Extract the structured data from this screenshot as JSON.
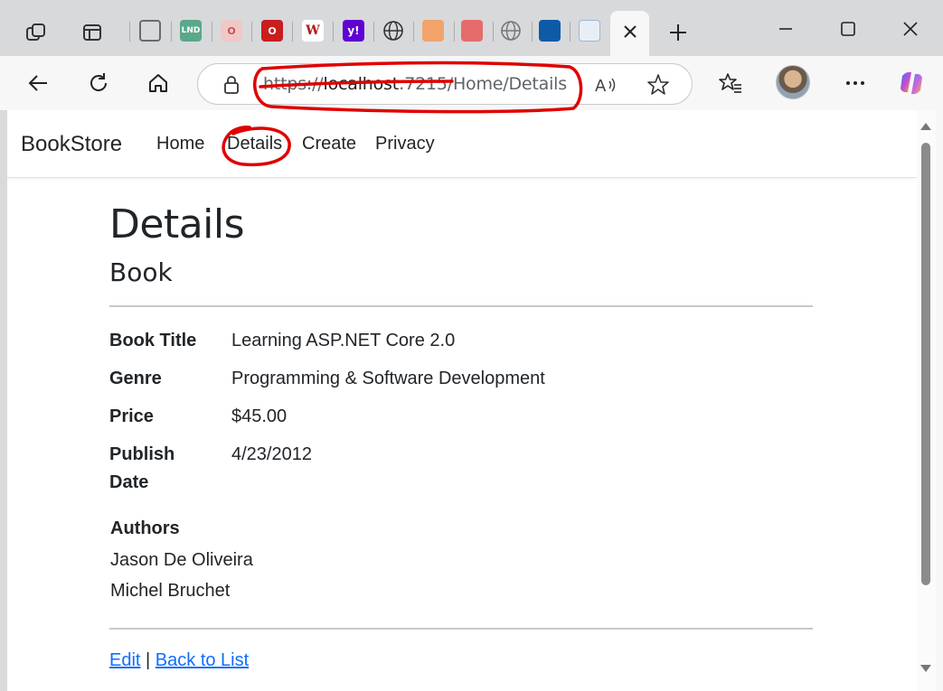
{
  "browser": {
    "url_scheme": "https://",
    "url_host": "localhost",
    "url_rest": ":7215/Home/Details",
    "tab_favicons": [
      {
        "name": "tab-favicon-workspace",
        "text": "",
        "color": "#6b6b6b"
      },
      {
        "name": "tab-favicon-lnd",
        "text": "LND",
        "color": "#5aa88a"
      },
      {
        "name": "tab-favicon-opera-1",
        "text": "O",
        "color": "#e8a0a0"
      },
      {
        "name": "tab-favicon-opera-2",
        "text": "O",
        "color": "#c81e1e"
      },
      {
        "name": "tab-favicon-w",
        "text": "W",
        "color": "#ffffff"
      },
      {
        "name": "tab-favicon-yahoo",
        "text": "y!",
        "color": "#6001d2"
      },
      {
        "name": "tab-favicon-globe-1",
        "text": "",
        "color": "#444444"
      },
      {
        "name": "tab-favicon-orange",
        "text": "",
        "color": "#f2a36b"
      },
      {
        "name": "tab-favicon-red",
        "text": "",
        "color": "#e66c6c"
      },
      {
        "name": "tab-favicon-globe-2",
        "text": "",
        "color": "#777777"
      },
      {
        "name": "tab-favicon-blue",
        "text": "",
        "color": "#0d5aa7"
      },
      {
        "name": "tab-favicon-doc",
        "text": "",
        "color": "#9bb7d4"
      }
    ]
  },
  "navbar": {
    "brand": "BookStore",
    "links": [
      "Home",
      "Details",
      "Create",
      "Privacy"
    ]
  },
  "page": {
    "title": "Details",
    "subtitle": "Book",
    "fields": [
      {
        "label": "Book Title",
        "value": "Learning ASP.NET Core 2.0"
      },
      {
        "label": "Genre",
        "value": "Programming & Software Development"
      },
      {
        "label": "Price",
        "value": "$45.00"
      },
      {
        "label": "Publish Date",
        "value": "4/23/2012"
      }
    ],
    "authors_heading": "Authors",
    "authors": [
      "Jason De Oliveira",
      "Michel Bruchet"
    ],
    "edit_link": "Edit",
    "separator": "|",
    "back_link": "Back to List"
  },
  "colors": {
    "link": "#0d6efd",
    "annotation": "#e00000",
    "text": "#212529"
  },
  "icons": [
    "workspaces-icon",
    "tab-actions-icon",
    "close-icon",
    "new-tab-icon",
    "minimize-icon",
    "maximize-icon",
    "window-close-icon",
    "back-icon",
    "refresh-icon",
    "home-icon",
    "lock-icon",
    "read-aloud-icon",
    "favorite-icon",
    "favorites-icon",
    "more-icon",
    "copilot-icon"
  ]
}
